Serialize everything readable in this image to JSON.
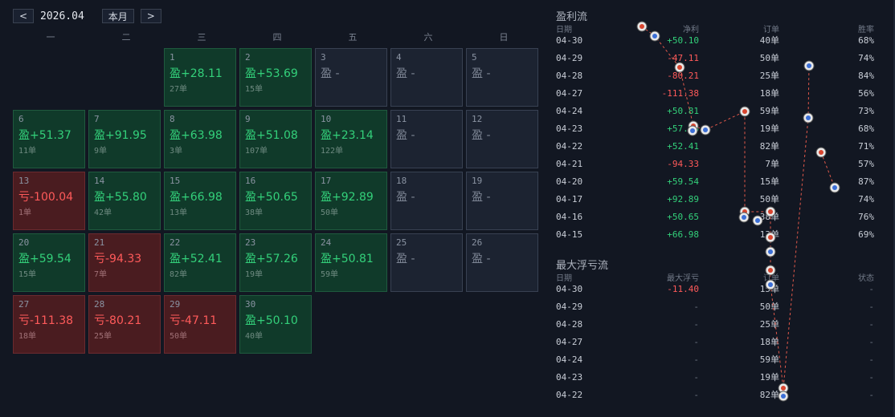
{
  "header": {
    "prev_label": "<",
    "month_label": "2026.04",
    "current_month_button": "本月",
    "next_label": ">"
  },
  "weekdays": [
    "一",
    "二",
    "三",
    "四",
    "五",
    "六",
    "日"
  ],
  "calendar": [
    {
      "day": "",
      "type": "empty"
    },
    {
      "day": "",
      "type": "empty"
    },
    {
      "day": "1",
      "type": "profit",
      "amount": "盈+28.11",
      "orders": "27单"
    },
    {
      "day": "2",
      "type": "profit",
      "amount": "盈+53.69",
      "orders": "15单"
    },
    {
      "day": "3",
      "type": "none",
      "amount": "盈 -",
      "orders": ""
    },
    {
      "day": "4",
      "type": "none",
      "amount": "盈 -",
      "orders": ""
    },
    {
      "day": "5",
      "type": "none",
      "amount": "盈 -",
      "orders": ""
    },
    {
      "day": "6",
      "type": "profit",
      "amount": "盈+51.37",
      "orders": "11单"
    },
    {
      "day": "7",
      "type": "profit",
      "amount": "盈+91.95",
      "orders": "9单"
    },
    {
      "day": "8",
      "type": "profit",
      "amount": "盈+63.98",
      "orders": "3单"
    },
    {
      "day": "9",
      "type": "profit",
      "amount": "盈+51.08",
      "orders": "107单"
    },
    {
      "day": "10",
      "type": "profit",
      "amount": "盈+23.14",
      "orders": "122单"
    },
    {
      "day": "11",
      "type": "none",
      "amount": "盈 -",
      "orders": ""
    },
    {
      "day": "12",
      "type": "none",
      "amount": "盈 -",
      "orders": ""
    },
    {
      "day": "13",
      "type": "loss",
      "amount": "亏-100.04",
      "orders": "1单"
    },
    {
      "day": "14",
      "type": "profit",
      "amount": "盈+55.80",
      "orders": "42单"
    },
    {
      "day": "15",
      "type": "profit",
      "amount": "盈+66.98",
      "orders": "13单"
    },
    {
      "day": "16",
      "type": "profit",
      "amount": "盈+50.65",
      "orders": "38单"
    },
    {
      "day": "17",
      "type": "profit",
      "amount": "盈+92.89",
      "orders": "50单"
    },
    {
      "day": "18",
      "type": "none",
      "amount": "盈 -",
      "orders": ""
    },
    {
      "day": "19",
      "type": "none",
      "amount": "盈 -",
      "orders": ""
    },
    {
      "day": "20",
      "type": "profit",
      "amount": "盈+59.54",
      "orders": "15单"
    },
    {
      "day": "21",
      "type": "loss",
      "amount": "亏-94.33",
      "orders": "7单"
    },
    {
      "day": "22",
      "type": "profit",
      "amount": "盈+52.41",
      "orders": "82单"
    },
    {
      "day": "23",
      "type": "profit",
      "amount": "盈+57.26",
      "orders": "19单"
    },
    {
      "day": "24",
      "type": "profit",
      "amount": "盈+50.81",
      "orders": "59单"
    },
    {
      "day": "25",
      "type": "none",
      "amount": "盈 -",
      "orders": ""
    },
    {
      "day": "26",
      "type": "none",
      "amount": "盈 -",
      "orders": ""
    },
    {
      "day": "27",
      "type": "loss",
      "amount": "亏-111.38",
      "orders": "18单"
    },
    {
      "day": "28",
      "type": "loss",
      "amount": "亏-80.21",
      "orders": "25单"
    },
    {
      "day": "29",
      "type": "loss",
      "amount": "亏-47.11",
      "orders": "50单"
    },
    {
      "day": "30",
      "type": "profit",
      "amount": "盈+50.10",
      "orders": "40单"
    }
  ],
  "profit_flow": {
    "title": "盈利流",
    "headers": [
      "日期",
      "净利",
      "订单",
      "胜率"
    ],
    "rows": [
      {
        "date": "04-30",
        "net": "+50.10",
        "sign": "pos",
        "orders": "40单",
        "winrate": "68%"
      },
      {
        "date": "04-29",
        "net": "-47.11",
        "sign": "neg",
        "orders": "50单",
        "winrate": "74%"
      },
      {
        "date": "04-28",
        "net": "-80.21",
        "sign": "neg",
        "orders": "25单",
        "winrate": "84%"
      },
      {
        "date": "04-27",
        "net": "-111.38",
        "sign": "neg",
        "orders": "18单",
        "winrate": "56%"
      },
      {
        "date": "04-24",
        "net": "+50.81",
        "sign": "pos",
        "orders": "59单",
        "winrate": "73%"
      },
      {
        "date": "04-23",
        "net": "+57.26",
        "sign": "pos",
        "orders": "19单",
        "winrate": "68%"
      },
      {
        "date": "04-22",
        "net": "+52.41",
        "sign": "pos",
        "orders": "82单",
        "winrate": "71%"
      },
      {
        "date": "04-21",
        "net": "-94.33",
        "sign": "neg",
        "orders": "7单",
        "winrate": "57%"
      },
      {
        "date": "04-20",
        "net": "+59.54",
        "sign": "pos",
        "orders": "15单",
        "winrate": "87%"
      },
      {
        "date": "04-17",
        "net": "+92.89",
        "sign": "pos",
        "orders": "50单",
        "winrate": "74%"
      },
      {
        "date": "04-16",
        "net": "+50.65",
        "sign": "pos",
        "orders": "38单",
        "winrate": "76%"
      },
      {
        "date": "04-15",
        "net": "+66.98",
        "sign": "pos",
        "orders": "13单",
        "winrate": "69%"
      }
    ]
  },
  "float_flow": {
    "title": "最大浮亏流",
    "headers": [
      "日期",
      "最大浮亏",
      "订单",
      "状态"
    ],
    "rows": [
      {
        "date": "04-30",
        "float": "-11.40",
        "sign": "neg",
        "orders": "15单",
        "status": "-"
      },
      {
        "date": "04-29",
        "float": "-",
        "sign": "dim",
        "orders": "50单",
        "status": "-"
      },
      {
        "date": "04-28",
        "float": "-",
        "sign": "dim",
        "orders": "25单",
        "status": "-"
      },
      {
        "date": "04-27",
        "float": "-",
        "sign": "dim",
        "orders": "18单",
        "status": "-"
      },
      {
        "date": "04-24",
        "float": "-",
        "sign": "dim",
        "orders": "59单",
        "status": "-"
      },
      {
        "date": "04-23",
        "float": "-",
        "sign": "dim",
        "orders": "19单",
        "status": "-"
      },
      {
        "date": "04-22",
        "float": "-",
        "sign": "dim",
        "orders": "82单",
        "status": "-"
      }
    ]
  },
  "colors": {
    "profit": "#33d07a",
    "loss": "#ff5a5a",
    "background": "#121722"
  }
}
